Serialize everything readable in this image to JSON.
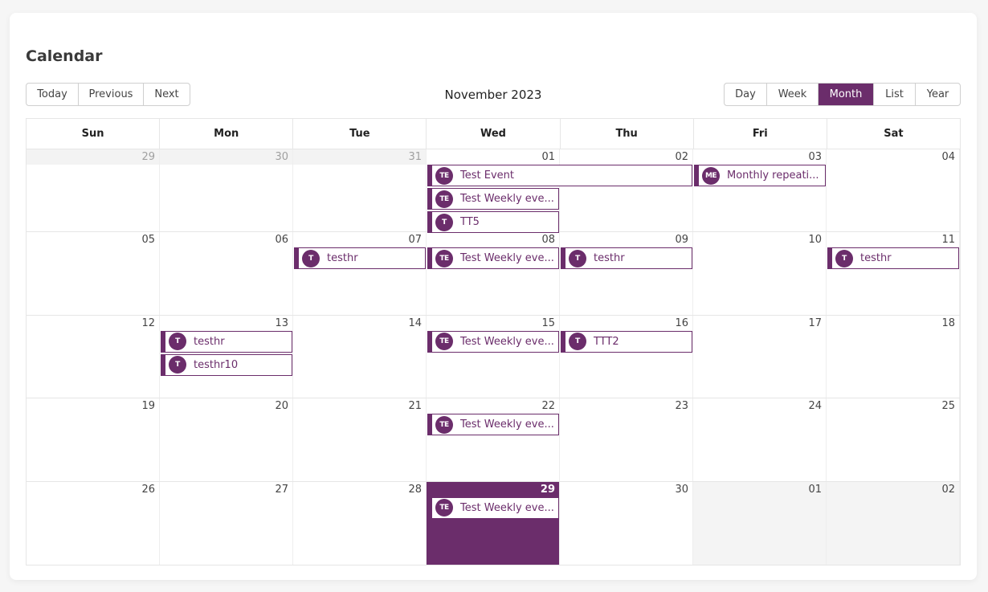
{
  "page": {
    "title": "Calendar"
  },
  "calendar": {
    "title": "November 2023",
    "accent_color": "#6b2d6b",
    "nav_buttons": [
      {
        "id": "today",
        "label": "Today"
      },
      {
        "id": "previous",
        "label": "Previous"
      },
      {
        "id": "next",
        "label": "Next"
      }
    ],
    "view_buttons": [
      {
        "id": "day",
        "label": "Day",
        "active": false
      },
      {
        "id": "week",
        "label": "Week",
        "active": false
      },
      {
        "id": "month",
        "label": "Month",
        "active": true
      },
      {
        "id": "list",
        "label": "List",
        "active": false
      },
      {
        "id": "year",
        "label": "Year",
        "active": false
      }
    ],
    "weekdays": [
      "Sun",
      "Mon",
      "Tue",
      "Wed",
      "Thu",
      "Fri",
      "Sat"
    ],
    "weeks": [
      {
        "days": [
          {
            "num": "29",
            "state": "other-head"
          },
          {
            "num": "30",
            "state": "other-head"
          },
          {
            "num": "31",
            "state": "other-head"
          },
          {
            "num": "01",
            "state": "current"
          },
          {
            "num": "02",
            "state": "current"
          },
          {
            "num": "03",
            "state": "current"
          },
          {
            "num": "04",
            "state": "current"
          }
        ]
      },
      {
        "days": [
          {
            "num": "05",
            "state": "current"
          },
          {
            "num": "06",
            "state": "current"
          },
          {
            "num": "07",
            "state": "current"
          },
          {
            "num": "08",
            "state": "current"
          },
          {
            "num": "09",
            "state": "current"
          },
          {
            "num": "10",
            "state": "current"
          },
          {
            "num": "11",
            "state": "current"
          }
        ]
      },
      {
        "days": [
          {
            "num": "12",
            "state": "current"
          },
          {
            "num": "13",
            "state": "current"
          },
          {
            "num": "14",
            "state": "current"
          },
          {
            "num": "15",
            "state": "current"
          },
          {
            "num": "16",
            "state": "current"
          },
          {
            "num": "17",
            "state": "current"
          },
          {
            "num": "18",
            "state": "current"
          }
        ]
      },
      {
        "days": [
          {
            "num": "19",
            "state": "current"
          },
          {
            "num": "20",
            "state": "current"
          },
          {
            "num": "21",
            "state": "current"
          },
          {
            "num": "22",
            "state": "current"
          },
          {
            "num": "23",
            "state": "current"
          },
          {
            "num": "24",
            "state": "current"
          },
          {
            "num": "25",
            "state": "current"
          }
        ]
      },
      {
        "days": [
          {
            "num": "26",
            "state": "current"
          },
          {
            "num": "27",
            "state": "current"
          },
          {
            "num": "28",
            "state": "current"
          },
          {
            "num": "29",
            "state": "today"
          },
          {
            "num": "30",
            "state": "current"
          },
          {
            "num": "01",
            "state": "other-full"
          },
          {
            "num": "02",
            "state": "other-full"
          }
        ]
      }
    ],
    "events": [
      {
        "week": 0,
        "col": 3,
        "span": 2,
        "row": 0,
        "badge": "TE",
        "label": "Test Event"
      },
      {
        "week": 0,
        "col": 3,
        "span": 1,
        "row": 1,
        "badge": "TE",
        "label": "Test Weekly eve..."
      },
      {
        "week": 0,
        "col": 3,
        "span": 1,
        "row": 2,
        "badge": "T",
        "label": "TT5"
      },
      {
        "week": 0,
        "col": 5,
        "span": 1,
        "row": 0,
        "badge": "ME",
        "label": "Monthly repeati..."
      },
      {
        "week": 1,
        "col": 2,
        "span": 1,
        "row": 0,
        "badge": "T",
        "label": "testhr"
      },
      {
        "week": 1,
        "col": 3,
        "span": 1,
        "row": 0,
        "badge": "TE",
        "label": "Test Weekly eve..."
      },
      {
        "week": 1,
        "col": 4,
        "span": 1,
        "row": 0,
        "badge": "T",
        "label": "testhr"
      },
      {
        "week": 1,
        "col": 6,
        "span": 1,
        "row": 0,
        "badge": "T",
        "label": "testhr"
      },
      {
        "week": 2,
        "col": 1,
        "span": 1,
        "row": 0,
        "badge": "T",
        "label": "testhr"
      },
      {
        "week": 2,
        "col": 1,
        "span": 1,
        "row": 1,
        "badge": "T",
        "label": "testhr10"
      },
      {
        "week": 2,
        "col": 3,
        "span": 1,
        "row": 0,
        "badge": "TE",
        "label": "Test Weekly eve..."
      },
      {
        "week": 2,
        "col": 4,
        "span": 1,
        "row": 0,
        "badge": "T",
        "label": "TTT2"
      },
      {
        "week": 3,
        "col": 3,
        "span": 1,
        "row": 0,
        "badge": "TE",
        "label": "Test Weekly eve..."
      },
      {
        "week": 4,
        "col": 3,
        "span": 1,
        "row": 0,
        "badge": "TE",
        "label": "Test Weekly eve..."
      }
    ]
  }
}
